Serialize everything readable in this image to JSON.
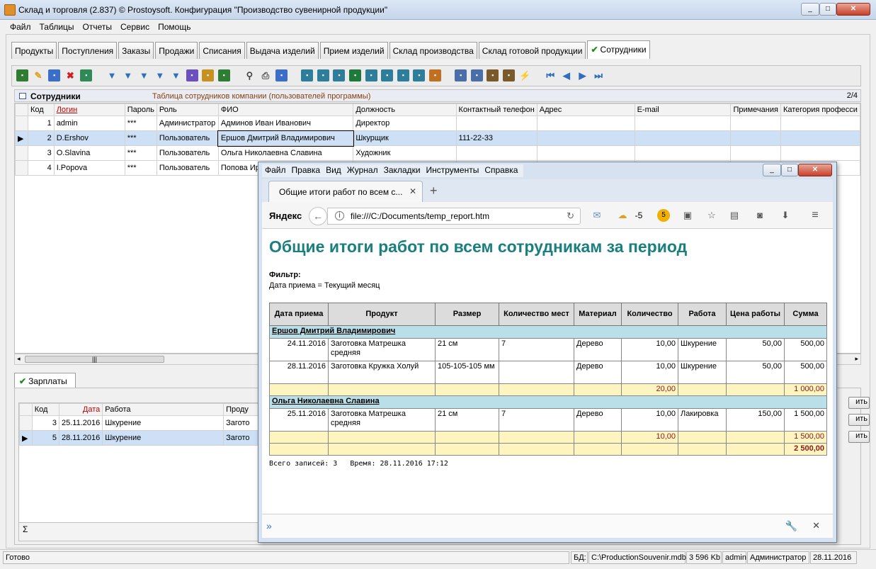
{
  "window": {
    "title": "Склад и торговля (2.837) © Prostoysoft. Конфигурация \"Производство сувенирной продукции\""
  },
  "menu": [
    "Файл",
    "Таблицы",
    "Отчеты",
    "Сервис",
    "Помощь"
  ],
  "tabs": [
    "Продукты",
    "Поступления",
    "Заказы",
    "Продажи",
    "Списания",
    "Выдача изделий",
    "Прием изделий",
    "Склад производства",
    "Склад готовой продукции",
    "Сотрудники"
  ],
  "active_tab": "Сотрудники",
  "toolbar_icons": [
    "export-icon",
    "edit-icon",
    "copy-icon",
    "delete-icon",
    "refresh-icon",
    "filter-icon",
    "filter-clear-icon",
    "filter-remove-icon",
    "filter-icon",
    "filter-icon",
    "sort-icon",
    "group-icon",
    "sql-icon",
    "find-icon",
    "print-icon",
    "preview-icon",
    "report-icon",
    "report-icon",
    "report-icon",
    "excel-icon",
    "report-icon",
    "report-icon",
    "report-icon",
    "report-icon",
    "chart-icon",
    "document-icon",
    "document-icon",
    "list-icon",
    "list-icon",
    "lightning-icon",
    "first-icon",
    "prev-icon",
    "next-icon",
    "last-icon"
  ],
  "employees": {
    "title": "Сотрудники",
    "subtitle": "Таблица сотрудников компании (пользователей программы)",
    "counter": "2/4",
    "columns": [
      "Код",
      "Логин",
      "Пароль",
      "Роль",
      "ФИО",
      "Должность",
      "Контактный телефон",
      "Адрес",
      "E-mail",
      "Примечания",
      "Категория професси"
    ],
    "rows": [
      {
        "code": "1",
        "login": "admin",
        "password": "***",
        "role": "Администратор",
        "fio": "Админов Иван Иванович",
        "position": "Директор",
        "phone": "",
        "selected": false
      },
      {
        "code": "2",
        "login": "D.Ershov",
        "password": "***",
        "role": "Пользователь",
        "fio": "Ершов Дмитрий Владимирович",
        "position": "Шкурщик",
        "phone": "111-22-33",
        "selected": true
      },
      {
        "code": "3",
        "login": "O.Slavina",
        "password": "***",
        "role": "Пользователь",
        "fio": "Ольга Николаевна Славина",
        "position": "Художник",
        "phone": "",
        "selected": false
      },
      {
        "code": "4",
        "login": "I.Popova",
        "password": "***",
        "role": "Пользователь",
        "fio": "Попова Ир",
        "position": "",
        "phone": "",
        "selected": false
      }
    ]
  },
  "salaries": {
    "tab_label": "Зарплаты",
    "columns": [
      "Код",
      "Дата",
      "Работа",
      "Проду"
    ],
    "rows": [
      {
        "code": "3",
        "date": "25.11.2016",
        "work": "Шкурение",
        "product": "Загото",
        "selected": false
      },
      {
        "code": "5",
        "date": "28.11.2016",
        "work": "Шкурение",
        "product": "Загото",
        "selected": true
      }
    ],
    "side_buttons": [
      "ить",
      "ить",
      "ить"
    ],
    "sum_symbol": "Σ"
  },
  "statusbar": {
    "ready": "Готово",
    "db_label": "БД:",
    "db_path": "C:\\ProductionSouvenir.mdb",
    "size": "3 596 Kb",
    "user": "admin",
    "role": "Администратор",
    "date": "28.11.2016"
  },
  "browser": {
    "menu": [
      "Файл",
      "Правка",
      "Вид",
      "Журнал",
      "Закладки",
      "Инструменты",
      "Справка"
    ],
    "tab_title": "Общие итоги работ по всем с...",
    "logo": "Яндекс",
    "url": "file:///C:/Documents/temp_report.htm",
    "weather": "-5",
    "badge": "5"
  },
  "report": {
    "title": "Общие итоги работ по всем сотрудникам за период",
    "filter_label": "Фильтр:",
    "filter_value": "Дата приема = Текущий месяц",
    "columns": [
      "Дата приема",
      "Продукт",
      "Размер",
      "Количество мест",
      "Материал",
      "Количество",
      "Работа",
      "Цена работы",
      "Сумма"
    ],
    "groups": [
      {
        "name": "Ершов Дмитрий Владимирович",
        "rows": [
          {
            "date": "24.11.2016",
            "product": "Заготовка Матрешка средняя",
            "size": "21 см",
            "places": "7",
            "material": "Дерево",
            "qty": "10,00",
            "work": "Шкурение",
            "price": "50,00",
            "sum": "500,00"
          },
          {
            "date": "28.11.2016",
            "product": "Заготовка Кружка Холуй",
            "size": "105-105-105 мм",
            "places": "",
            "material": "Дерево",
            "qty": "10,00",
            "work": "Шкурение",
            "price": "50,00",
            "sum": "500,00"
          }
        ],
        "subtotal_qty": "20,00",
        "subtotal_sum": "1 000,00"
      },
      {
        "name": "Ольга Николаевна Славина",
        "rows": [
          {
            "date": "25.11.2016",
            "product": "Заготовка Матрешка средняя",
            "size": "21 см",
            "places": "7",
            "material": "Дерево",
            "qty": "10,00",
            "work": "Лакировка",
            "price": "150,00",
            "sum": "1 500,00"
          }
        ],
        "subtotal_qty": "10,00",
        "subtotal_sum": "1 500,00"
      }
    ],
    "grand_total": "2 500,00",
    "footer": "Всего записей: 3   Время: 28.11.2016 17:12"
  }
}
